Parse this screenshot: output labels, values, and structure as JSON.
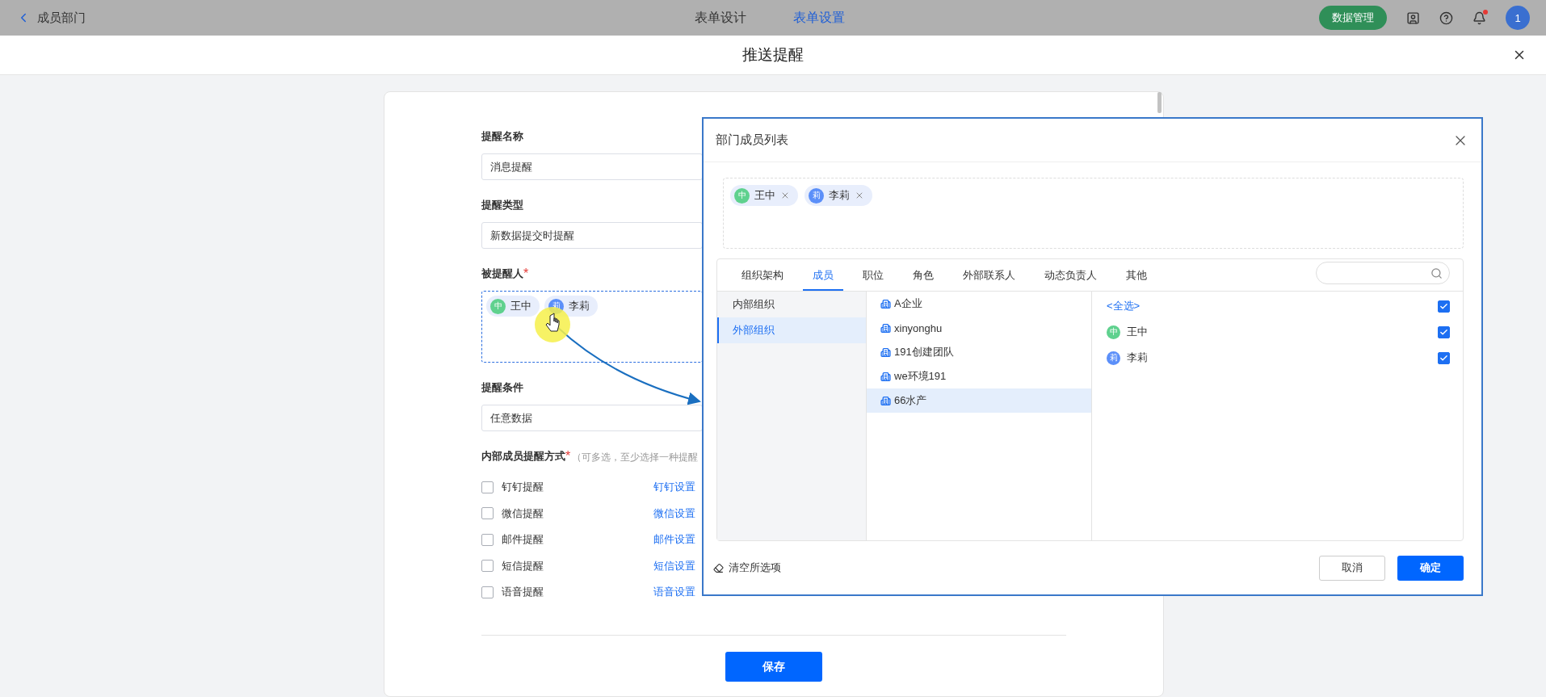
{
  "topbar": {
    "back_label": "成员部门",
    "tabs": [
      {
        "label": "表单设计",
        "selected": false
      },
      {
        "label": "表单设置",
        "selected": true
      }
    ],
    "data_button": "数据管理",
    "avatar": "1"
  },
  "page_header": {
    "title": "推送提醒"
  },
  "form": {
    "fields": [
      {
        "kind": "input",
        "label": "提醒名称",
        "value": "消息提醒"
      },
      {
        "kind": "input",
        "label": "提醒类型",
        "value": "新数据提交时提醒"
      },
      {
        "kind": "people",
        "label": "被提醒人",
        "mark": "*",
        "people": [
          {
            "avatar": "中",
            "name": "王中",
            "color": "#5fd18e"
          },
          {
            "avatar": "莉",
            "name": "李莉",
            "color": "#5b8ff9"
          }
        ]
      },
      {
        "kind": "input",
        "label": "提醒条件",
        "value": "任意数据"
      }
    ],
    "methods_label": "内部成员提醒方式",
    "methods_mark": "*",
    "methods_hint": "（可多选，至少选择一种提醒",
    "methods": [
      {
        "label": "钉钉提醒",
        "checked": false,
        "link": "钉钉设置"
      },
      {
        "label": "微信提醒",
        "checked": false,
        "link": "微信设置"
      },
      {
        "label": "邮件提醒",
        "checked": false,
        "link": "邮件设置"
      },
      {
        "label": "短信提醒",
        "checked": false,
        "link": "短信设置"
      },
      {
        "label": "语音提醒",
        "checked": false,
        "link": "语音设置"
      }
    ],
    "save": "保存"
  },
  "dialog": {
    "title": "部门成员列表",
    "chosen": [
      {
        "avatar": "中",
        "name": "王中",
        "color": "#5fd18e"
      },
      {
        "avatar": "莉",
        "name": "李莉",
        "color": "#5b8ff9"
      }
    ],
    "tabs": [
      {
        "label": "组织架构",
        "selected": false
      },
      {
        "label": "成员",
        "selected": true
      },
      {
        "label": "职位",
        "selected": false
      },
      {
        "label": "角色",
        "selected": false
      },
      {
        "label": "外部联系人",
        "selected": false
      },
      {
        "label": "动态负责人",
        "selected": false
      },
      {
        "label": "其他",
        "selected": false
      }
    ],
    "groups": [
      {
        "label": "内部组织",
        "selected": false
      },
      {
        "label": "外部组织",
        "selected": true
      }
    ],
    "orgs": [
      {
        "label": "A企业",
        "selected": false
      },
      {
        "label": "xinyonghu",
        "selected": false
      },
      {
        "label": "191创建团队",
        "selected": false
      },
      {
        "label": "we环境191",
        "selected": false
      },
      {
        "label": "66水产",
        "selected": true
      }
    ],
    "select_all": {
      "label": "<全选>",
      "checked": true
    },
    "members": [
      {
        "avatar": "中",
        "name": "王中",
        "color": "#5fd18e",
        "checked": true
      },
      {
        "avatar": "莉",
        "name": "李莉",
        "color": "#5b8ff9",
        "checked": true
      }
    ],
    "clear": "清空所选项",
    "cancel": "取消",
    "confirm": "确定"
  }
}
